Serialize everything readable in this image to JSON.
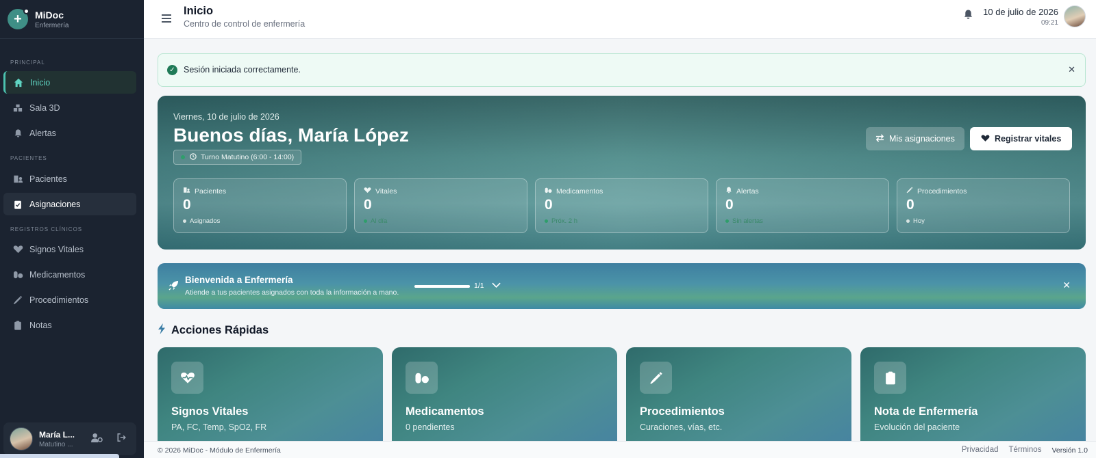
{
  "brand": {
    "name": "MiDoc",
    "subtitle": "Enfermería"
  },
  "sidebar": {
    "sections": [
      "PRINCIPAL",
      "PACIENTES",
      "REGISTROS CLÍNICOS"
    ],
    "items": [
      {
        "label": "Inicio",
        "icon": "home-icon",
        "state": "active"
      },
      {
        "label": "Sala 3D",
        "icon": "cubes-icon"
      },
      {
        "label": "Alertas",
        "icon": "bell-icon"
      },
      {
        "label": "Pacientes",
        "icon": "hospital-user-icon"
      },
      {
        "label": "Asignaciones",
        "icon": "clipboard-check-icon",
        "state": "selected"
      },
      {
        "label": "Signos Vitales",
        "icon": "heart-pulse-icon"
      },
      {
        "label": "Medicamentos",
        "icon": "pills-icon"
      },
      {
        "label": "Procedimientos",
        "icon": "syringe-icon"
      },
      {
        "label": "Notas",
        "icon": "clipboard-icon"
      }
    ],
    "user": {
      "name": "María L...",
      "shift": "Matutino ..."
    }
  },
  "header": {
    "title": "Inicio",
    "subtitle": "Centro de control de enfermería",
    "date": "10 de julio de 2026",
    "time": "09:21"
  },
  "alert": {
    "message": "Sesión iniciada correctamente.",
    "color": "#eefaf5"
  },
  "hero": {
    "date": "Viernes, 10 de julio de 2026",
    "greeting": "Buenos días, María López",
    "shift": "Turno Matutino (6:00 - 14:00)",
    "btn_assignments": "Mis asignaciones",
    "btn_vitals": "Registrar vitales",
    "stats": [
      {
        "label": "Pacientes",
        "value": "0",
        "foot": "Asignados"
      },
      {
        "label": "Vitales",
        "value": "0",
        "foot": "Al día"
      },
      {
        "label": "Medicamentos",
        "value": "0",
        "foot": "Próx. 2 h"
      },
      {
        "label": "Alertas",
        "value": "0",
        "foot": "Sin alertas"
      },
      {
        "label": "Procedimientos",
        "value": "0",
        "foot": "Hoy"
      }
    ]
  },
  "welcome": {
    "title": "Bienvenida a Enfermería",
    "subtitle": "Atiende a tus pacientes asignados con toda la información a mano.",
    "step": "1/1",
    "progress": 1.0
  },
  "quick_actions": {
    "title": "Acciones Rápidas",
    "cards": [
      {
        "title": "Signos Vitales",
        "subtitle": "PA, FC, Temp, SpO2, FR"
      },
      {
        "title": "Medicamentos",
        "subtitle": "0 pendientes"
      },
      {
        "title": "Procedimientos",
        "subtitle": "Curaciones, vías, etc."
      },
      {
        "title": "Nota de Enfermería",
        "subtitle": "Evolución del paciente"
      }
    ]
  },
  "footer": {
    "copyright": "© 2026 MiDoc - Módulo de Enfermería",
    "privacy": "Privacidad",
    "terms": "Términos",
    "version": "Versión 1.0"
  },
  "colors": {
    "sidebar": "#1b2330",
    "accent": "#4cc3b0",
    "hero": "#3f8580"
  }
}
